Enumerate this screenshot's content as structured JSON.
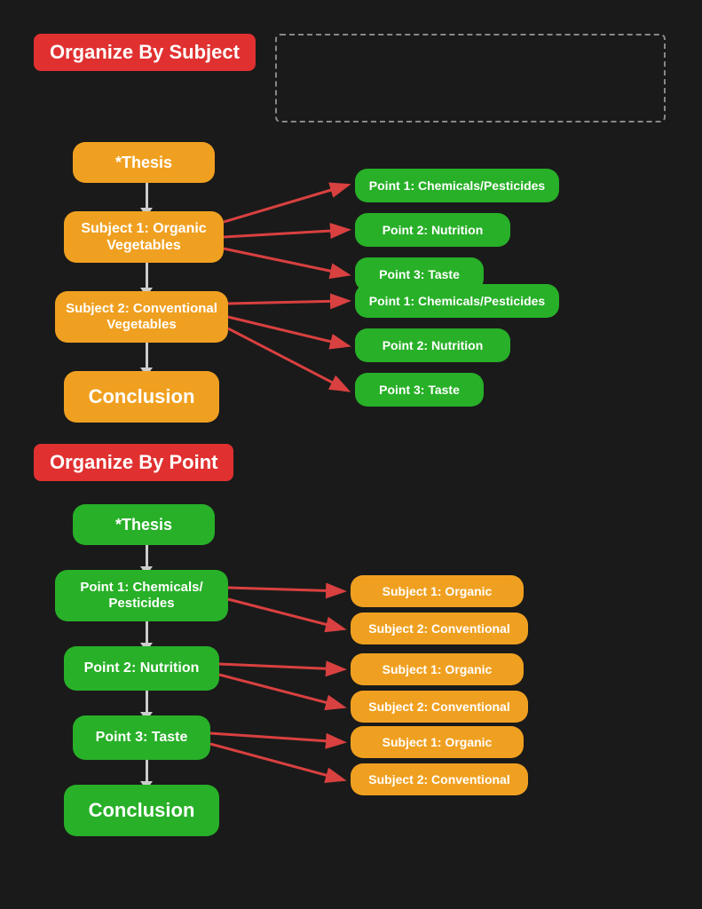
{
  "section1": {
    "header": "Organize By Subject",
    "nodes": {
      "thesis": "*Thesis",
      "subject1": "Subject 1: Organic Vegetables",
      "subject2": "Subject 2: Conventional Vegetables",
      "conclusion": "Conclusion"
    },
    "points_s1": [
      "Point 1: Chemicals/Pesticides",
      "Point 2: Nutrition",
      "Point 3: Taste"
    ],
    "points_s2": [
      "Point 1: Chemicals/Pesticides",
      "Point 2: Nutrition",
      "Point 3: Taste"
    ],
    "dashed_box_label": ""
  },
  "section2": {
    "header": "Organize By Point",
    "nodes": {
      "thesis": "*Thesis",
      "point1": "Point 1: Chemicals/ Pesticides",
      "point2": "Point 2: Nutrition",
      "point3": "Point 3: Taste",
      "conclusion": "Conclusion"
    },
    "subjects_p1": [
      "Subject 1: Organic",
      "Subject 2: Conventional"
    ],
    "subjects_p2": [
      "Subject 1: Organic",
      "Subject 2: Conventional"
    ],
    "subjects_p3": [
      "Subject 1: Organic",
      "Subject 2: Conventional"
    ]
  }
}
